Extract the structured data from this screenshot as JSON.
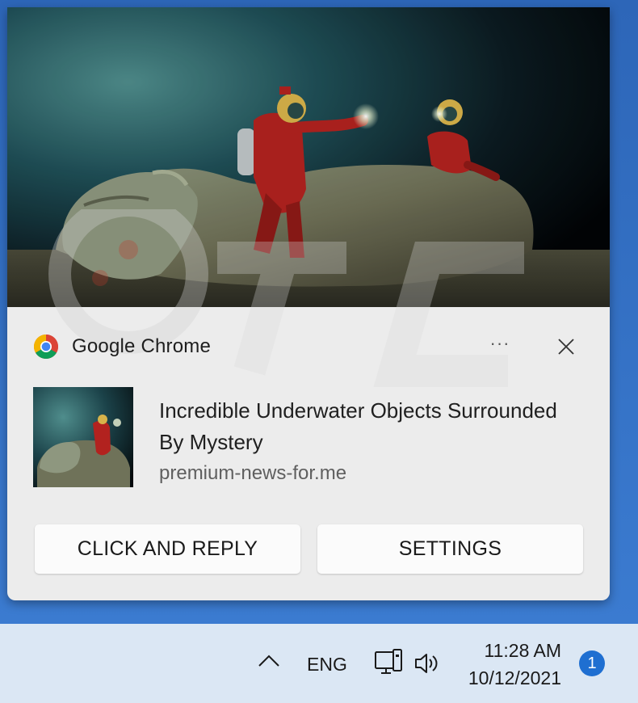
{
  "notification": {
    "app_name": "Google Chrome",
    "more_icon": "ellipsis-icon",
    "more_label": "···",
    "close_icon": "close-icon",
    "title": "Incredible Underwater Objects Surrounded By Mystery",
    "domain": "premium-news-for.me",
    "buttons": {
      "reply": "CLICK AND REPLY",
      "settings": "SETTINGS"
    },
    "accent": "#1f6fd1"
  },
  "taskbar": {
    "chevron_icon": "chevron-up-icon",
    "language": "ENG",
    "network_icon": "network-icon",
    "volume_icon": "speaker-icon",
    "time": "11:28 AM",
    "date": "10/12/2021",
    "notification_count": "1"
  },
  "watermark": {
    "text": "PCrisk.com"
  }
}
